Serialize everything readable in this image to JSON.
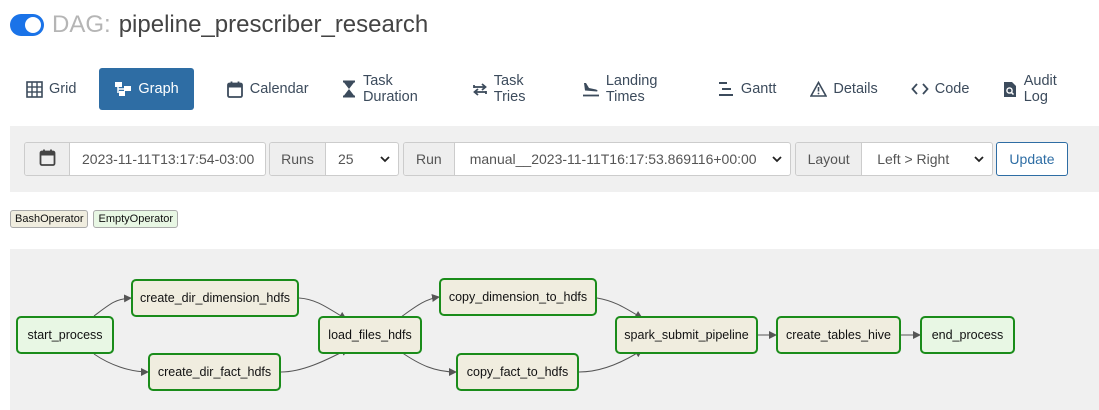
{
  "header": {
    "dag_prefix": "DAG:",
    "dag_id": "pipeline_prescriber_research",
    "toggle_state": "on"
  },
  "tabs": [
    {
      "label": "Grid",
      "icon": "grid-icon"
    },
    {
      "label": "Graph",
      "icon": "graph-icon",
      "active": true
    },
    {
      "label": "Calendar",
      "icon": "calendar-icon"
    },
    {
      "label": "Task Duration",
      "icon": "hourglass-icon"
    },
    {
      "label": "Task Tries",
      "icon": "retry-icon"
    },
    {
      "label": "Landing Times",
      "icon": "landing-icon"
    },
    {
      "label": "Gantt",
      "icon": "gantt-icon"
    },
    {
      "label": "Details",
      "icon": "warning-icon"
    },
    {
      "label": "Code",
      "icon": "code-icon"
    },
    {
      "label": "Audit Log",
      "icon": "audit-log-icon"
    }
  ],
  "filters": {
    "base_date": "2023-11-11T13:17:54-03:00",
    "runs_label": "Runs",
    "runs_value": "25",
    "run_label": "Run",
    "run_value": "manual__2023-11-11T16:17:53.869116+00:00",
    "layout_label": "Layout",
    "layout_value": "Left > Right",
    "update_label": "Update"
  },
  "legend": [
    "BashOperator",
    "EmptyOperator"
  ],
  "colors": {
    "accent": "#2e6da4",
    "toggle": "#1a73e8",
    "success_border": "#1a8c1a",
    "bash_fill": "#f0eddf",
    "empty_fill": "#e8f7e4"
  },
  "graph": {
    "nodes": [
      {
        "id": "start_process",
        "operator": "EmptyOperator"
      },
      {
        "id": "create_dir_dimension_hdfs",
        "operator": "BashOperator"
      },
      {
        "id": "create_dir_fact_hdfs",
        "operator": "BashOperator"
      },
      {
        "id": "load_files_hdfs",
        "operator": "BashOperator"
      },
      {
        "id": "copy_dimension_to_hdfs",
        "operator": "BashOperator"
      },
      {
        "id": "copy_fact_to_hdfs",
        "operator": "BashOperator"
      },
      {
        "id": "spark_submit_pipeline",
        "operator": "BashOperator"
      },
      {
        "id": "create_tables_hive",
        "operator": "BashOperator"
      },
      {
        "id": "end_process",
        "operator": "EmptyOperator"
      }
    ],
    "edges": [
      [
        "start_process",
        "create_dir_dimension_hdfs"
      ],
      [
        "start_process",
        "create_dir_fact_hdfs"
      ],
      [
        "create_dir_dimension_hdfs",
        "load_files_hdfs"
      ],
      [
        "create_dir_fact_hdfs",
        "load_files_hdfs"
      ],
      [
        "load_files_hdfs",
        "copy_dimension_to_hdfs"
      ],
      [
        "load_files_hdfs",
        "copy_fact_to_hdfs"
      ],
      [
        "copy_dimension_to_hdfs",
        "spark_submit_pipeline"
      ],
      [
        "copy_fact_to_hdfs",
        "spark_submit_pipeline"
      ],
      [
        "spark_submit_pipeline",
        "create_tables_hive"
      ],
      [
        "create_tables_hive",
        "end_process"
      ]
    ]
  }
}
